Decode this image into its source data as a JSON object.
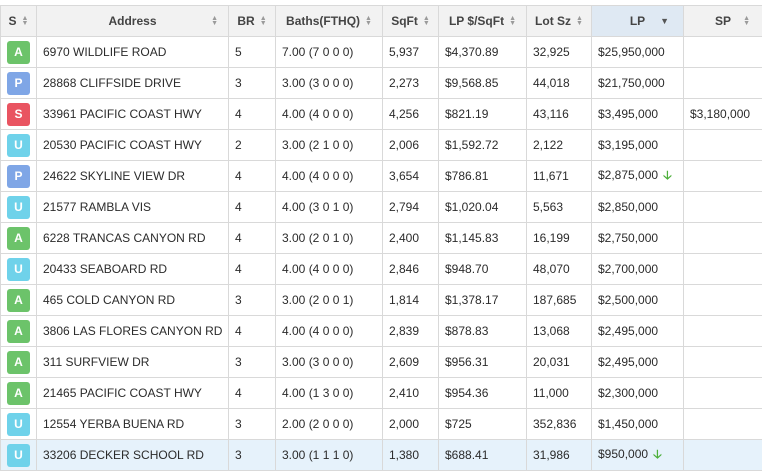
{
  "colors": {
    "A": "#6cc36a",
    "P": "#7fa6e6",
    "S": "#e95461",
    "U": "#6fd2ea",
    "arrow": "#4caf3a"
  },
  "columns": {
    "status": "S",
    "address": "Address",
    "br": "BR",
    "baths": "Baths(FTHQ)",
    "sqft": "SqFt",
    "lp_sqft": "LP $/SqFt",
    "lot": "Lot Sz",
    "lp": "LP",
    "sp": "SP"
  },
  "rows": [
    {
      "status": "A",
      "address": "6970 WILDLIFE ROAD",
      "br": "5",
      "baths": "7.00 (7 0 0 0)",
      "sqft": "5,937",
      "lp_sqft": "$4,370.89",
      "lot": "32,925",
      "lp": "$25,950,000",
      "arrow": "",
      "sp": ""
    },
    {
      "status": "P",
      "address": "28868 CLIFFSIDE DRIVE",
      "br": "3",
      "baths": "3.00 (3 0 0 0)",
      "sqft": "2,273",
      "lp_sqft": "$9,568.85",
      "lot": "44,018",
      "lp": "$21,750,000",
      "arrow": "",
      "sp": ""
    },
    {
      "status": "S",
      "address": "33961 PACIFIC COAST HWY",
      "br": "4",
      "baths": "4.00 (4 0 0 0)",
      "sqft": "4,256",
      "lp_sqft": "$821.19",
      "lot": "43,116",
      "lp": "$3,495,000",
      "arrow": "",
      "sp": "$3,180,000"
    },
    {
      "status": "U",
      "address": "20530 PACIFIC COAST HWY",
      "br": "2",
      "baths": "3.00 (2 1 0 0)",
      "sqft": "2,006",
      "lp_sqft": "$1,592.72",
      "lot": "2,122",
      "lp": "$3,195,000",
      "arrow": "",
      "sp": ""
    },
    {
      "status": "P",
      "address": "24622 SKYLINE VIEW DR",
      "br": "4",
      "baths": "4.00 (4 0 0 0)",
      "sqft": "3,654",
      "lp_sqft": "$786.81",
      "lot": "11,671",
      "lp": "$2,875,000",
      "arrow": "🡣",
      "sp": ""
    },
    {
      "status": "U",
      "address": "21577 RAMBLA VIS",
      "br": "4",
      "baths": "4.00 (3 0 1 0)",
      "sqft": "2,794",
      "lp_sqft": "$1,020.04",
      "lot": "5,563",
      "lp": "$2,850,000",
      "arrow": "",
      "sp": ""
    },
    {
      "status": "A",
      "address": "6228 TRANCAS CANYON RD",
      "br": "4",
      "baths": "3.00 (2 0 1 0)",
      "sqft": "2,400",
      "lp_sqft": "$1,145.83",
      "lot": "16,199",
      "lp": "$2,750,000",
      "arrow": "",
      "sp": ""
    },
    {
      "status": "U",
      "address": "20433 SEABOARD RD",
      "br": "4",
      "baths": "4.00 (4 0 0 0)",
      "sqft": "2,846",
      "lp_sqft": "$948.70",
      "lot": "48,070",
      "lp": "$2,700,000",
      "arrow": "",
      "sp": ""
    },
    {
      "status": "A",
      "address": "465 COLD CANYON RD",
      "br": "3",
      "baths": "3.00 (2 0 0 1)",
      "sqft": "1,814",
      "lp_sqft": "$1,378.17",
      "lot": "187,685",
      "lp": "$2,500,000",
      "arrow": "",
      "sp": ""
    },
    {
      "status": "A",
      "address": "3806 LAS FLORES CANYON RD",
      "br": "4",
      "baths": "4.00 (4 0 0 0)",
      "sqft": "2,839",
      "lp_sqft": "$878.83",
      "lot": "13,068",
      "lp": "$2,495,000",
      "arrow": "",
      "sp": ""
    },
    {
      "status": "A",
      "address": "311 SURFVIEW DR",
      "br": "3",
      "baths": "3.00 (3 0 0 0)",
      "sqft": "2,609",
      "lp_sqft": "$956.31",
      "lot": "20,031",
      "lp": "$2,495,000",
      "arrow": "",
      "sp": ""
    },
    {
      "status": "A",
      "address": "21465 PACIFIC COAST HWY",
      "br": "4",
      "baths": "4.00 (1 3 0 0)",
      "sqft": "2,410",
      "lp_sqft": "$954.36",
      "lot": "11,000",
      "lp": "$2,300,000",
      "arrow": "",
      "sp": ""
    },
    {
      "status": "U",
      "address": "12554 YERBA BUENA RD",
      "br": "3",
      "baths": "2.00 (2 0 0 0)",
      "sqft": "2,000",
      "lp_sqft": "$725",
      "lot": "352,836",
      "lp": "$1,450,000",
      "arrow": "",
      "sp": ""
    },
    {
      "status": "U",
      "address": "33206 DECKER SCHOOL RD",
      "br": "3",
      "baths": "3.00 (1 1 1 0)",
      "sqft": "1,380",
      "lp_sqft": "$688.41",
      "lot": "31,986",
      "lp": "$950,000",
      "arrow": "🡣",
      "sp": "",
      "highlight": true
    }
  ]
}
